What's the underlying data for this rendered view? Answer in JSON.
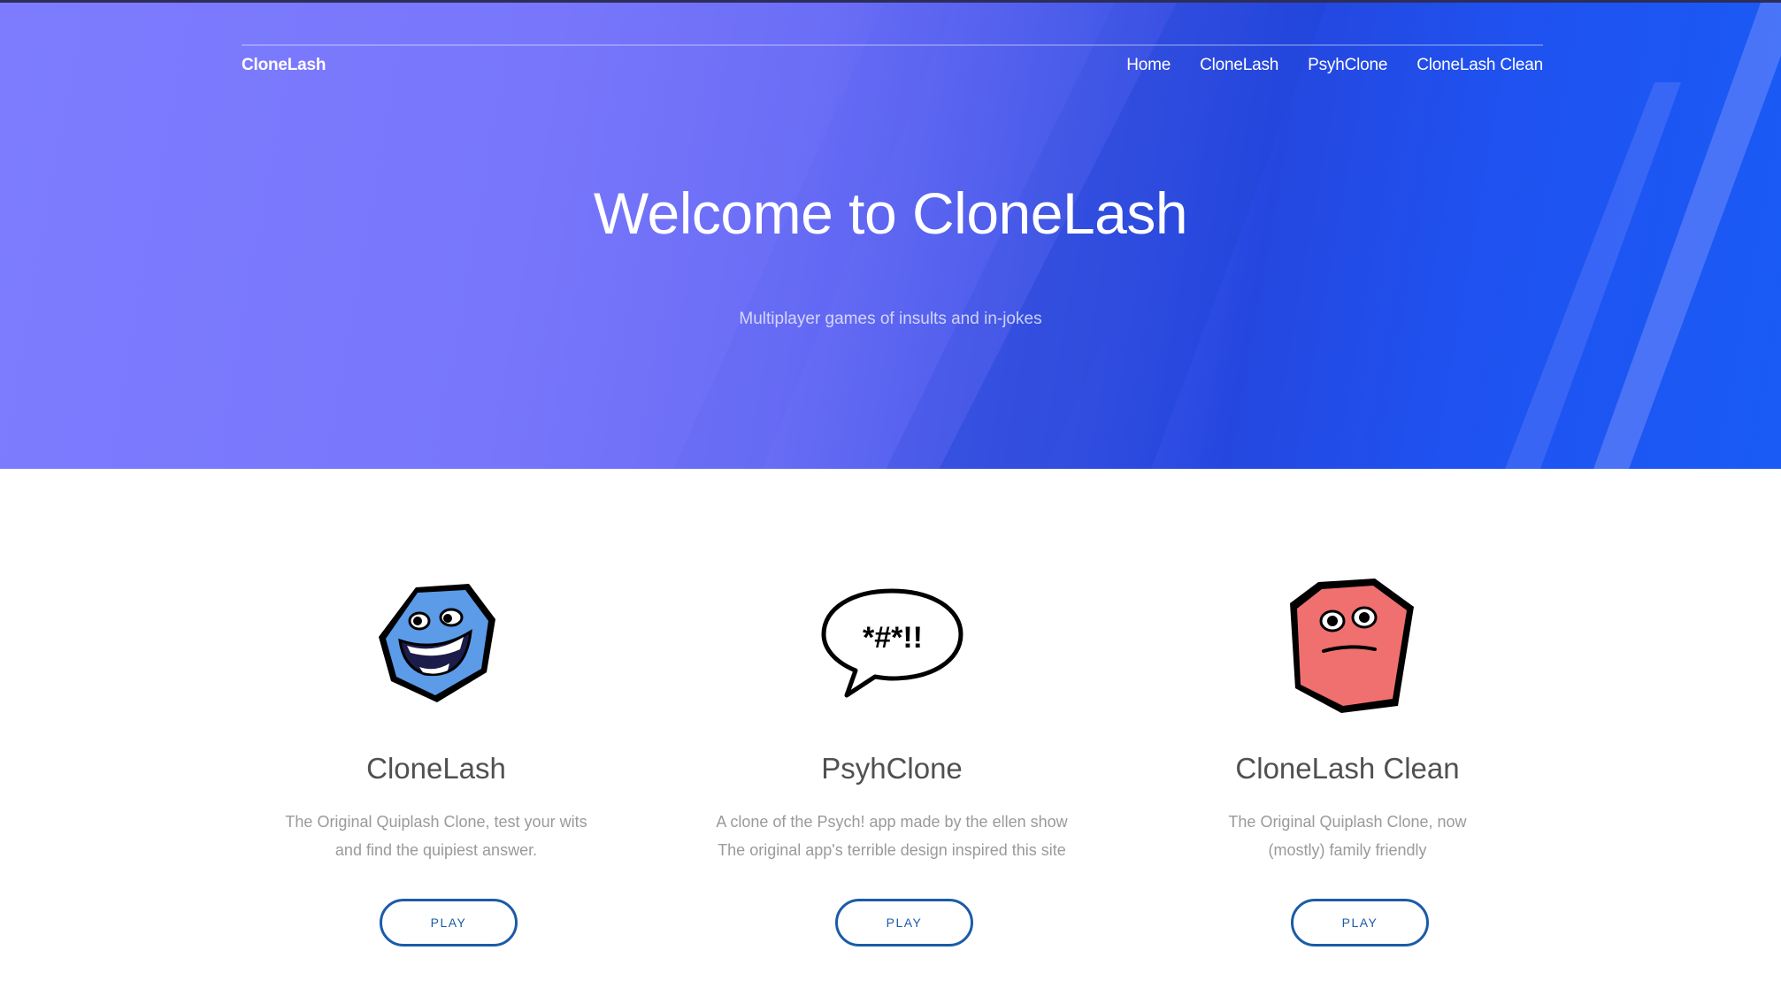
{
  "nav": {
    "brand": "CloneLash",
    "links": [
      "Home",
      "CloneLash",
      "PsyhClone",
      "CloneLash Clean"
    ]
  },
  "hero": {
    "title": "Welcome to CloneLash",
    "subtitle": "Multiplayer games of insults and in-jokes"
  },
  "games": [
    {
      "name": "CloneLash",
      "icon": "blue-smiling-hexagon-icon",
      "desc_lines": [
        "The Original Quiplash Clone, test your wits",
        "and find the quipiest answer."
      ],
      "button": "PLAY"
    },
    {
      "name": "PsyhClone",
      "icon": "speech-bubble-icon",
      "icon_text": "*#*!!",
      "desc_lines": [
        "A clone of the Psych! app made by the ellen show",
        "The original app's terrible design inspired this site"
      ],
      "button": "PLAY"
    },
    {
      "name": "CloneLash Clean",
      "icon": "red-frowning-hexagon-icon",
      "desc_lines": [
        "The Original Quiplash Clone, now",
        "(mostly) family friendly"
      ],
      "button": "PLAY"
    }
  ],
  "colors": {
    "hero_light": "#7d7cff",
    "hero_dark": "#1a5bf5",
    "button": "#1a5ba8",
    "blue_icon": "#5b9be8",
    "red_icon": "#f07070"
  }
}
